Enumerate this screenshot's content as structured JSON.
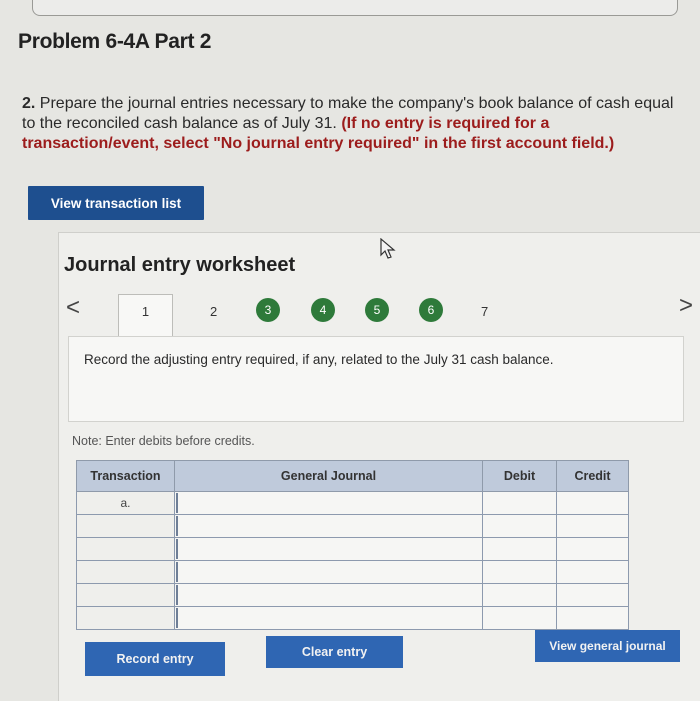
{
  "page": {
    "problem_title": "Problem 6-4A Part 2",
    "instruction_number": "2.",
    "instruction_text": " Prepare the journal entries necessary to make the company's book balance of cash equal to the reconciled cash balance as of July 31. ",
    "instruction_requirement": "(If no entry is required for a transaction/event, select \"No journal entry required\" in the first account field.)",
    "view_transactions_label": "View transaction list"
  },
  "worksheet": {
    "title": "Journal entry worksheet",
    "nav_prev": "<",
    "nav_next": ">",
    "tabs": [
      {
        "label": "1",
        "state": "active"
      },
      {
        "label": "2",
        "state": "plain"
      },
      {
        "label": "3",
        "state": "done"
      },
      {
        "label": "4",
        "state": "done"
      },
      {
        "label": "5",
        "state": "done"
      },
      {
        "label": "6",
        "state": "done"
      },
      {
        "label": "7",
        "state": "plain"
      }
    ],
    "prompt": "Record the adjusting entry required, if any, related to the July 31 cash balance.",
    "note": "Note: Enter debits before credits."
  },
  "journal_table": {
    "headers": [
      "Transaction",
      "General Journal",
      "Debit",
      "Credit"
    ],
    "rows": [
      {
        "transaction": "a.",
        "account": "",
        "debit": "",
        "credit": ""
      },
      {
        "transaction": "",
        "account": "",
        "debit": "",
        "credit": ""
      },
      {
        "transaction": "",
        "account": "",
        "debit": "",
        "credit": ""
      },
      {
        "transaction": "",
        "account": "",
        "debit": "",
        "credit": ""
      },
      {
        "transaction": "",
        "account": "",
        "debit": "",
        "credit": ""
      },
      {
        "transaction": "",
        "account": "",
        "debit": "",
        "credit": ""
      }
    ]
  },
  "buttons": {
    "record": "Record entry",
    "clear": "Clear entry",
    "view_journal": "View general journal"
  },
  "colors": {
    "primary_button": "#2f66b3",
    "dark_button": "#1e4f8f",
    "completed_tab": "#2e7a3a",
    "requirement_text": "#9c1c1c",
    "table_header": "#bfcadb"
  }
}
